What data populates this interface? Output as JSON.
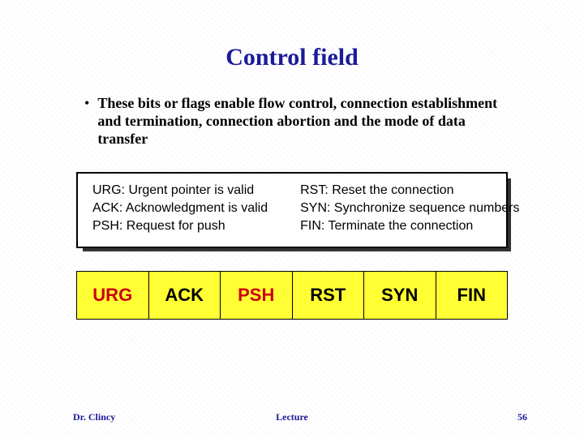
{
  "title": "Control field",
  "bullet": "These bits or flags enable flow control, connection establishment and termination, connection abortion and the mode of data transfer",
  "defs": {
    "left": [
      "URG: Urgent pointer is valid",
      "ACK: Acknowledgment is valid",
      "PSH: Request for push"
    ],
    "right": [
      "RST: Reset the connection",
      "SYN: Synchronize sequence numbers",
      "FIN: Terminate the connection"
    ]
  },
  "flags": [
    {
      "label": "URG",
      "color": "red"
    },
    {
      "label": "ACK",
      "color": "black"
    },
    {
      "label": "PSH",
      "color": "red"
    },
    {
      "label": "RST",
      "color": "black"
    },
    {
      "label": "SYN",
      "color": "black"
    },
    {
      "label": "FIN",
      "color": "black"
    }
  ],
  "footer": {
    "author": "Dr. Clincy",
    "center": "Lecture",
    "page": "56"
  }
}
